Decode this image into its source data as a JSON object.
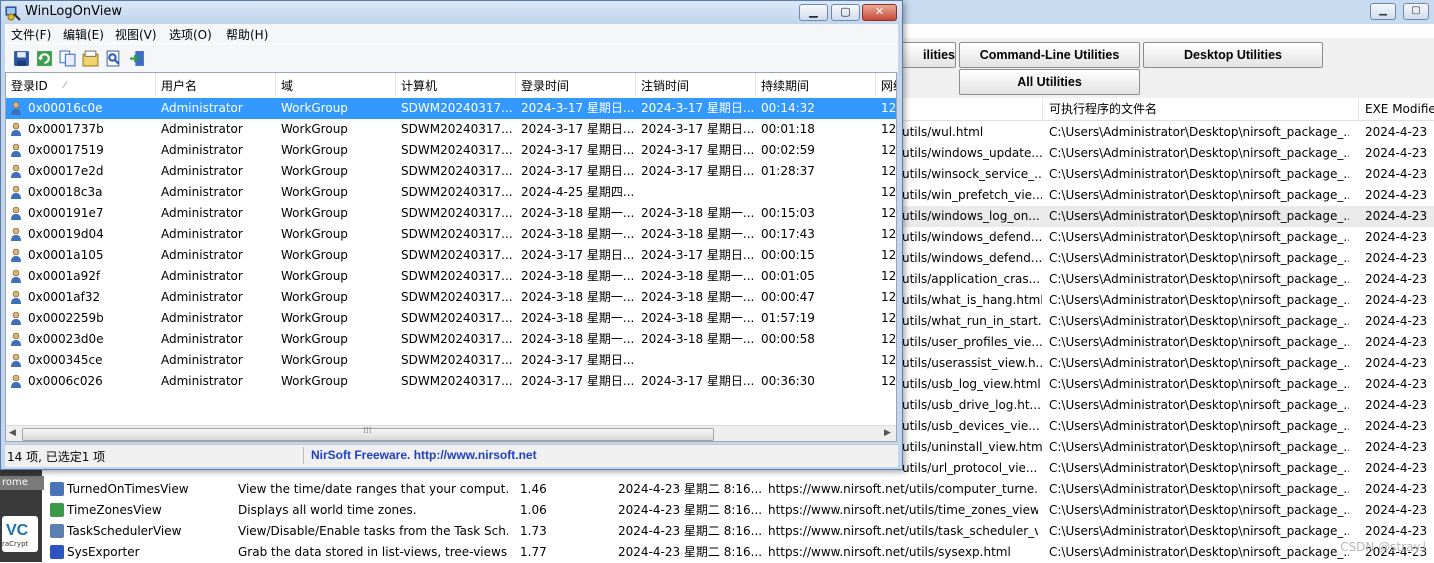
{
  "background_window": {
    "buttons": [
      "ilities",
      "Command-Line Utilities",
      "Desktop Utilities",
      "All Utilities"
    ],
    "headers": [
      "可执行程序的文件名",
      "EXE Modifie"
    ],
    "rows": [
      {
        "url": "utils/wul.html",
        "path": "C:\\Users\\Administrator\\Desktop\\nirsoft_package_...",
        "date": "2024-4-23"
      },
      {
        "url": "utils/windows_update...",
        "path": "C:\\Users\\Administrator\\Desktop\\nirsoft_package_...",
        "date": "2024-4-23"
      },
      {
        "url": "utils/winsock_service_...",
        "path": "C:\\Users\\Administrator\\Desktop\\nirsoft_package_...",
        "date": "2024-4-23"
      },
      {
        "url": "utils/win_prefetch_vie...",
        "path": "C:\\Users\\Administrator\\Desktop\\nirsoft_package_...",
        "date": "2024-4-23"
      },
      {
        "url": "utils/windows_log_on...",
        "path": "C:\\Users\\Administrator\\Desktop\\nirsoft_package_...",
        "date": "2024-4-23"
      },
      {
        "url": "utils/windows_defend...",
        "path": "C:\\Users\\Administrator\\Desktop\\nirsoft_package_...",
        "date": "2024-4-23"
      },
      {
        "url": "utils/windows_defend...",
        "path": "C:\\Users\\Administrator\\Desktop\\nirsoft_package_...",
        "date": "2024-4-23"
      },
      {
        "url": "utils/application_cras...",
        "path": "C:\\Users\\Administrator\\Desktop\\nirsoft_package_...",
        "date": "2024-4-23"
      },
      {
        "url": "utils/what_is_hang.html",
        "path": "C:\\Users\\Administrator\\Desktop\\nirsoft_package_...",
        "date": "2024-4-23"
      },
      {
        "url": "utils/what_run_in_start...",
        "path": "C:\\Users\\Administrator\\Desktop\\nirsoft_package_...",
        "date": "2024-4-23"
      },
      {
        "url": "utils/user_profiles_vie...",
        "path": "C:\\Users\\Administrator\\Desktop\\nirsoft_package_...",
        "date": "2024-4-23"
      },
      {
        "url": "utils/userassist_view.h...",
        "path": "C:\\Users\\Administrator\\Desktop\\nirsoft_package_...",
        "date": "2024-4-23"
      },
      {
        "url": "utils/usb_log_view.html",
        "path": "C:\\Users\\Administrator\\Desktop\\nirsoft_package_...",
        "date": "2024-4-23"
      },
      {
        "url": "utils/usb_drive_log.ht...",
        "path": "C:\\Users\\Administrator\\Desktop\\nirsoft_package_...",
        "date": "2024-4-23"
      },
      {
        "url": "utils/usb_devices_vie...",
        "path": "C:\\Users\\Administrator\\Desktop\\nirsoft_package_...",
        "date": "2024-4-23"
      },
      {
        "url": "utils/uninstall_view.html",
        "path": "C:\\Users\\Administrator\\Desktop\\nirsoft_package_...",
        "date": "2024-4-23"
      },
      {
        "url": "utils/url_protocol_vie...",
        "path": "C:\\Users\\Administrator\\Desktop\\nirsoft_package_...",
        "date": "2024-4-23"
      }
    ],
    "full_rows": [
      {
        "name": "TurnedOnTimesView",
        "desc": "View the time/date ranges that your comput...",
        "ver": "1.46",
        "date": "2024-4-23 星期二 8:16...",
        "url": "https://www.nirsoft.net/utils/computer_turne...",
        "path": "C:\\Users\\Administrator\\Desktop\\nirsoft_package_...",
        "exe_date": "2024-4-23",
        "icon_color": "#4a74b8"
      },
      {
        "name": "TimeZonesView",
        "desc": "Displays all world time zones.",
        "ver": "1.06",
        "date": "2024-4-23 星期二 8:16...",
        "url": "https://www.nirsoft.net/utils/time_zones_view....",
        "path": "C:\\Users\\Administrator\\Desktop\\nirsoft_package_...",
        "exe_date": "2024-4-23",
        "icon_color": "#3a9a4a"
      },
      {
        "name": "TaskSchedulerView",
        "desc": "View/Disable/Enable tasks from the Task Sch...",
        "ver": "1.73",
        "date": "2024-4-23 星期二 8:16...",
        "url": "https://www.nirsoft.net/utils/task_scheduler_v...",
        "path": "C:\\Users\\Administrator\\Desktop\\nirsoft_package_...",
        "exe_date": "2024-4-23",
        "icon_color": "#5a7fb0"
      },
      {
        "name": "SysExporter",
        "desc": "Grab the data stored in list-views, tree-views,...",
        "ver": "1.77",
        "date": "2024-4-23 星期二 8:16...",
        "url": "https://www.nirsoft.net/utils/sysexp.html",
        "path": "C:\\Users\\Administrator\\Desktop\\nirsoft_package_...",
        "exe_date": "2024-4-23",
        "icon_color": "#2d52c4"
      }
    ],
    "left_strip_labels": [
      "rome",
      "VC",
      "raCrypt"
    ],
    "watermark": "CSDN @stray.l"
  },
  "window": {
    "title": "WinLogOnView",
    "menu": [
      "文件(F)",
      "编辑(E)",
      "视图(V)",
      "选项(O)",
      "帮助(H)"
    ],
    "toolbar": [
      "save-icon",
      "refresh-icon",
      "copy-icon",
      "properties-icon",
      "find-icon",
      "exit-icon"
    ],
    "columns": [
      "登录ID",
      "用户名",
      "域",
      "计算机",
      "登录时间",
      "注销时间",
      "持续期间",
      "网络"
    ],
    "rows": [
      {
        "id": "0x00016c0e",
        "user": "Administrator",
        "domain": "WorkGroup",
        "computer": "SDWM20240317...",
        "logon": "2024-3-17 星期日...",
        "logoff": "2024-3-17 星期日...",
        "duration": "00:14:32",
        "net": "12"
      },
      {
        "id": "0x0001737b",
        "user": "Administrator",
        "domain": "WorkGroup",
        "computer": "SDWM20240317...",
        "logon": "2024-3-17 星期日...",
        "logoff": "2024-3-17 星期日...",
        "duration": "00:01:18",
        "net": "12"
      },
      {
        "id": "0x00017519",
        "user": "Administrator",
        "domain": "WorkGroup",
        "computer": "SDWM20240317...",
        "logon": "2024-3-17 星期日...",
        "logoff": "2024-3-17 星期日...",
        "duration": "00:02:59",
        "net": "12"
      },
      {
        "id": "0x00017e2d",
        "user": "Administrator",
        "domain": "WorkGroup",
        "computer": "SDWM20240317...",
        "logon": "2024-3-17 星期日...",
        "logoff": "2024-3-17 星期日...",
        "duration": "01:28:37",
        "net": "12"
      },
      {
        "id": "0x00018c3a",
        "user": "Administrator",
        "domain": "WorkGroup",
        "computer": "SDWM20240317...",
        "logon": "2024-4-25 星期四...",
        "logoff": "",
        "duration": "",
        "net": "12"
      },
      {
        "id": "0x000191e7",
        "user": "Administrator",
        "domain": "WorkGroup",
        "computer": "SDWM20240317...",
        "logon": "2024-3-18 星期一...",
        "logoff": "2024-3-18 星期一...",
        "duration": "00:15:03",
        "net": "12"
      },
      {
        "id": "0x00019d04",
        "user": "Administrator",
        "domain": "WorkGroup",
        "computer": "SDWM20240317...",
        "logon": "2024-3-18 星期一...",
        "logoff": "2024-3-18 星期一...",
        "duration": "00:17:43",
        "net": "12"
      },
      {
        "id": "0x0001a105",
        "user": "Administrator",
        "domain": "WorkGroup",
        "computer": "SDWM20240317...",
        "logon": "2024-3-17 星期日...",
        "logoff": "2024-3-17 星期日...",
        "duration": "00:00:15",
        "net": "12"
      },
      {
        "id": "0x0001a92f",
        "user": "Administrator",
        "domain": "WorkGroup",
        "computer": "SDWM20240317...",
        "logon": "2024-3-18 星期一...",
        "logoff": "2024-3-18 星期一...",
        "duration": "00:01:05",
        "net": "12"
      },
      {
        "id": "0x0001af32",
        "user": "Administrator",
        "domain": "WorkGroup",
        "computer": "SDWM20240317...",
        "logon": "2024-3-18 星期一...",
        "logoff": "2024-3-18 星期一...",
        "duration": "00:00:47",
        "net": "12"
      },
      {
        "id": "0x0002259b",
        "user": "Administrator",
        "domain": "WorkGroup",
        "computer": "SDWM20240317...",
        "logon": "2024-3-18 星期一...",
        "logoff": "2024-3-18 星期一...",
        "duration": "01:57:19",
        "net": "12"
      },
      {
        "id": "0x00023d0e",
        "user": "Administrator",
        "domain": "WorkGroup",
        "computer": "SDWM20240317...",
        "logon": "2024-3-18 星期一...",
        "logoff": "2024-3-18 星期一...",
        "duration": "00:00:58",
        "net": "12"
      },
      {
        "id": "0x000345ce",
        "user": "Administrator",
        "domain": "WorkGroup",
        "computer": "SDWM20240317...",
        "logon": "2024-3-17 星期日...",
        "logoff": "",
        "duration": "",
        "net": "12"
      },
      {
        "id": "0x0006c026",
        "user": "Administrator",
        "domain": "WorkGroup",
        "computer": "SDWM20240317...",
        "logon": "2024-3-17 星期日...",
        "logoff": "2024-3-17 星期日...",
        "duration": "00:36:30",
        "net": "12"
      }
    ],
    "selected_row": 0,
    "status": {
      "count": "14 项, 已选定1 项",
      "link": "NirSoft Freeware.  http://www.nirsoft.net"
    },
    "colors": {
      "selection": "#3399ff",
      "link": "#1f3fbf",
      "titlebar": "#c4d6ee"
    }
  }
}
